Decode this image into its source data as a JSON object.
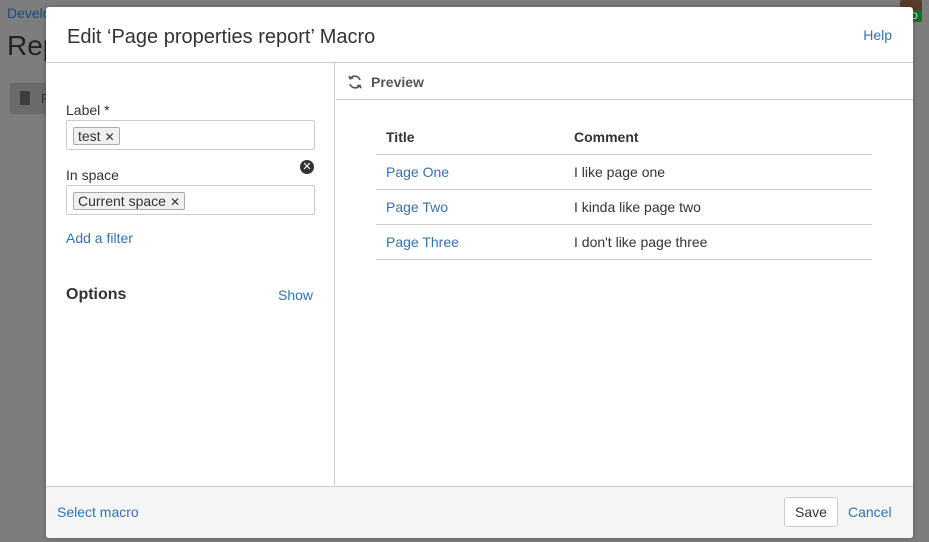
{
  "background": {
    "breadcrumb": "Develo",
    "page_title": "Rep",
    "button_text": "F"
  },
  "dialog": {
    "title": "Edit ‘Page properties report’ Macro",
    "help_label": "Help"
  },
  "left_panel": {
    "label_field": {
      "label": "Label *",
      "tags": [
        "test"
      ]
    },
    "space_field": {
      "label": "In space",
      "tags": [
        "Current space"
      ]
    },
    "add_filter_label": "Add a filter",
    "options_title": "Options",
    "options_toggle_label": "Show"
  },
  "preview": {
    "title": "Preview",
    "columns": [
      "Title",
      "Comment"
    ],
    "rows": [
      {
        "title": "Page One",
        "comment": "I like page one"
      },
      {
        "title": "Page Two",
        "comment": "I kinda like page two"
      },
      {
        "title": "Page Three",
        "comment": "I don't like page three"
      }
    ]
  },
  "footer": {
    "select_macro_label": "Select macro",
    "save_label": "Save",
    "cancel_label": "Cancel"
  },
  "colors": {
    "link": "#3572b0",
    "overlay": "#7d7d7d",
    "border": "#cccccc"
  },
  "icons": {
    "refresh": "refresh-icon",
    "remove_tag": "close-icon",
    "clear": "clear-icon"
  }
}
